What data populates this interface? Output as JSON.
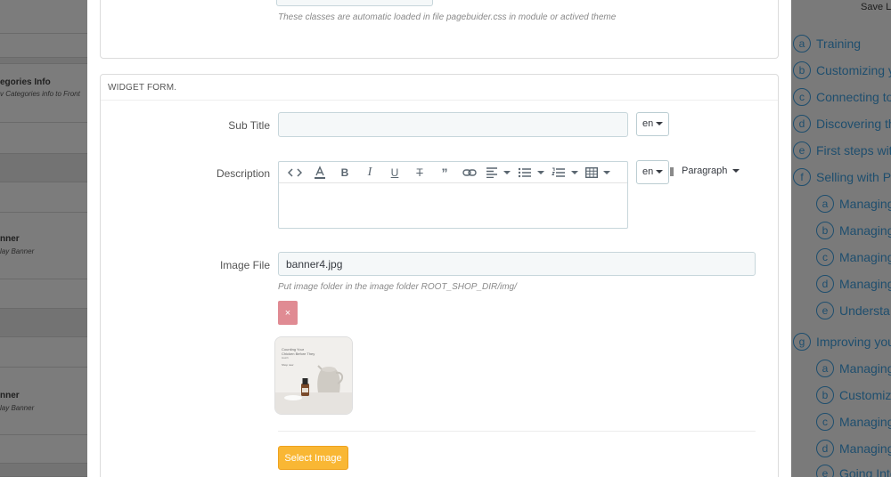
{
  "left_panel": {
    "items": [
      {
        "title": "egories Info",
        "subtitle": "v Categories info to Front"
      },
      {
        "title": "nner",
        "subtitle": "lay Banner"
      },
      {
        "title": "nner",
        "subtitle": "lay Banner"
      }
    ]
  },
  "modal": {
    "top_help": "These classes are automatic loaded in file pagebuider.css in module or actived theme",
    "widget_heading": "WIDGET FORM.",
    "sub_title": {
      "label": "Sub Title",
      "value": "",
      "lang": "en"
    },
    "description": {
      "label": "Description",
      "lang": "en",
      "paragraph": "Paragraph"
    },
    "image_file": {
      "label": "Image File",
      "value": "banner4.jpg",
      "help": "Put image folder in the image folder ROOT_SHOP_DIR/img/",
      "remove_label": "×",
      "thumb_text": [
        "Counting Your",
        "Chicken Before They",
        "Hatch",
        "Shop now"
      ]
    },
    "select_image_label": "Select Image"
  },
  "right_panel": {
    "save_label": "Save L",
    "nav": [
      {
        "badge": "a",
        "label": "Training",
        "level": 0
      },
      {
        "badge": "b",
        "label": "Customizing y",
        "level": 0
      },
      {
        "badge": "c",
        "label": "Connecting to",
        "level": 0
      },
      {
        "badge": "d",
        "label": "Discovering th",
        "level": 0
      },
      {
        "badge": "e",
        "label": "First steps wit",
        "level": 0
      },
      {
        "badge": "f",
        "label": "Selling with Pr",
        "level": 0
      },
      {
        "badge": "a",
        "label": "Managing",
        "level": 1
      },
      {
        "badge": "b",
        "label": "Managing",
        "level": 1
      },
      {
        "badge": "c",
        "label": "Managing",
        "level": 1
      },
      {
        "badge": "d",
        "label": "Managing",
        "level": 1
      },
      {
        "badge": "e",
        "label": "Understa",
        "level": 1
      },
      {
        "badge": "g",
        "label": "Improving you",
        "level": 0
      },
      {
        "badge": "a",
        "label": "Managing",
        "level": 1
      },
      {
        "badge": "b",
        "label": "Customiz",
        "level": 1
      },
      {
        "badge": "c",
        "label": "Managing",
        "level": 1
      },
      {
        "badge": "d",
        "label": "Managing",
        "level": 1
      },
      {
        "badge": "e",
        "label": "Going Into",
        "level": 1
      }
    ]
  }
}
